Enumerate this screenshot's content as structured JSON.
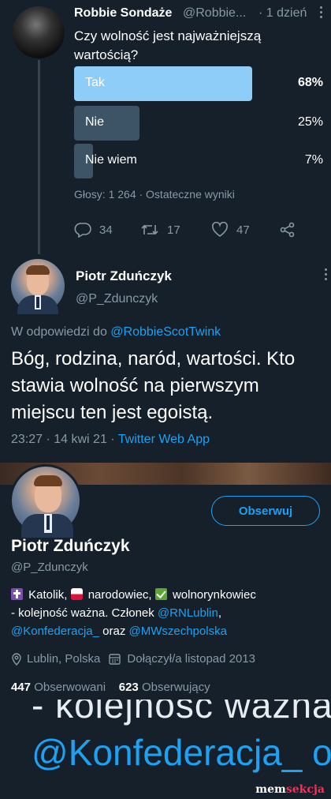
{
  "tweet1": {
    "name": "Robbie Sondaże",
    "handle": "@Robbie...",
    "time": "· 1 dzień",
    "text": "Czy wolność jest najważniejszą wartością?",
    "poll": [
      {
        "label": "Tak",
        "pct_text": "68%",
        "pct": 68,
        "winner": true
      },
      {
        "label": "Nie",
        "pct_text": "25%",
        "pct": 25,
        "winner": false
      },
      {
        "label": "Nie wiem",
        "pct_text": "7%",
        "pct": 7,
        "winner": false
      }
    ],
    "poll_meta": "Głosy: 1 264 · Ostateczne wyniki",
    "replies": "34",
    "retweets": "17",
    "likes": "47"
  },
  "tweet2": {
    "name": "Piotr Zduńczyk",
    "handle": "@P_Zdunczyk",
    "reply_prefix": "W odpowiedzi do ",
    "reply_link": "@RobbieScotTwink",
    "text": "Bóg, rodzina, naród, wartości. Kto stawia wolność na pierwszym miejscu ten jest egoistą.",
    "time": "23:27 · 14 kwi 21 · ",
    "source": "Twitter Web App"
  },
  "profile": {
    "follow_label": "Obserwuj",
    "name": "Piotr Zduńczyk",
    "handle": "@P_Zdunczyk",
    "bio_1": "Katolik, ",
    "bio_2": "narodowiec, ",
    "bio_3": "wolnorynkowiec",
    "bio_4": "- kolejność ważna.  Członek ",
    "bio_link1": "@RNLublin",
    "bio_5": ",",
    "bio_link2": "@Konfederacja_",
    "bio_6": " oraz ",
    "bio_link3": "@MWszechpolska",
    "location": "Lublin, Polska",
    "joined": "Dołączył/a listopad 2013",
    "following_count": "447",
    "following_label": "Obserwowani",
    "followers_count": "623",
    "followers_label": "Obserwujący"
  },
  "zoom": {
    "line1": "- kolejność ważna",
    "line2": "@Konfederacja_ o"
  },
  "watermark": {
    "part1": "mem",
    "part2": "sekcja"
  },
  "colors": {
    "background": "#15202b",
    "accent": "#1da1f2",
    "poll_winner": "#8ecdf8",
    "poll_other": "#3d5466",
    "muted": "#8899a6"
  }
}
